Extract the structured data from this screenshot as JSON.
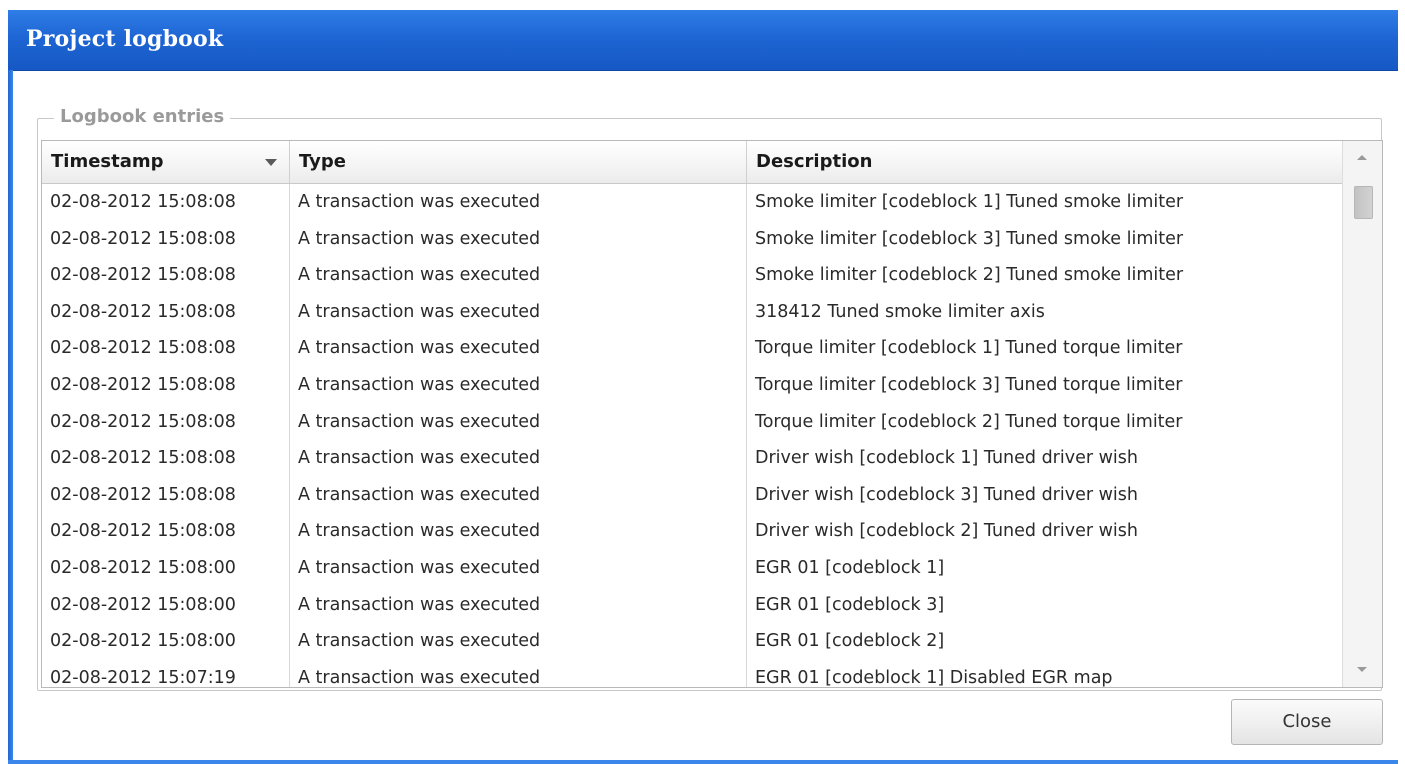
{
  "window": {
    "title": "Project logbook"
  },
  "logbook": {
    "legend": "Logbook entries",
    "sort_column": "Timestamp",
    "sort_direction": "descending",
    "columns": [
      {
        "key": "timestamp",
        "label": "Timestamp"
      },
      {
        "key": "type",
        "label": "Type"
      },
      {
        "key": "description",
        "label": "Description"
      }
    ],
    "rows": [
      {
        "timestamp": "02-08-2012 15:08:08",
        "type": "A transaction was executed",
        "description": "Smoke limiter [codeblock 1] Tuned smoke limiter"
      },
      {
        "timestamp": "02-08-2012 15:08:08",
        "type": "A transaction was executed",
        "description": "Smoke limiter [codeblock 3] Tuned smoke limiter"
      },
      {
        "timestamp": "02-08-2012 15:08:08",
        "type": "A transaction was executed",
        "description": "Smoke limiter [codeblock 2] Tuned smoke limiter"
      },
      {
        "timestamp": "02-08-2012 15:08:08",
        "type": "A transaction was executed",
        "description": "318412 Tuned smoke limiter axis"
      },
      {
        "timestamp": "02-08-2012 15:08:08",
        "type": "A transaction was executed",
        "description": "Torque limiter [codeblock 1] Tuned torque limiter"
      },
      {
        "timestamp": "02-08-2012 15:08:08",
        "type": "A transaction was executed",
        "description": "Torque limiter [codeblock 3] Tuned torque limiter"
      },
      {
        "timestamp": "02-08-2012 15:08:08",
        "type": "A transaction was executed",
        "description": "Torque limiter [codeblock 2] Tuned torque limiter"
      },
      {
        "timestamp": "02-08-2012 15:08:08",
        "type": "A transaction was executed",
        "description": "Driver wish [codeblock 1] Tuned driver wish"
      },
      {
        "timestamp": "02-08-2012 15:08:08",
        "type": "A transaction was executed",
        "description": "Driver wish [codeblock 3] Tuned driver wish"
      },
      {
        "timestamp": "02-08-2012 15:08:08",
        "type": "A transaction was executed",
        "description": "Driver wish [codeblock 2] Tuned driver wish"
      },
      {
        "timestamp": "02-08-2012 15:08:00",
        "type": "A transaction was executed",
        "description": "EGR 01 [codeblock 1]"
      },
      {
        "timestamp": "02-08-2012 15:08:00",
        "type": "A transaction was executed",
        "description": "EGR 01 [codeblock 3]"
      },
      {
        "timestamp": "02-08-2012 15:08:00",
        "type": "A transaction was executed",
        "description": "EGR 01 [codeblock 2]"
      },
      {
        "timestamp": "02-08-2012 15:07:19",
        "type": "A transaction was executed",
        "description": "EGR 01 [codeblock 1] Disabled EGR map"
      }
    ]
  },
  "footer": {
    "close_label": "Close"
  },
  "colors": {
    "titlebar": "#1e66d4",
    "titlebar_text": "#ffffff",
    "legend_text": "#9a9a9a",
    "header_text": "#1a1a1a",
    "cell_text": "#2a2a2a"
  },
  "icons": {
    "sort": "chevron-down-icon",
    "scroll_up": "arrow-up-icon",
    "scroll_down": "arrow-down-icon"
  }
}
